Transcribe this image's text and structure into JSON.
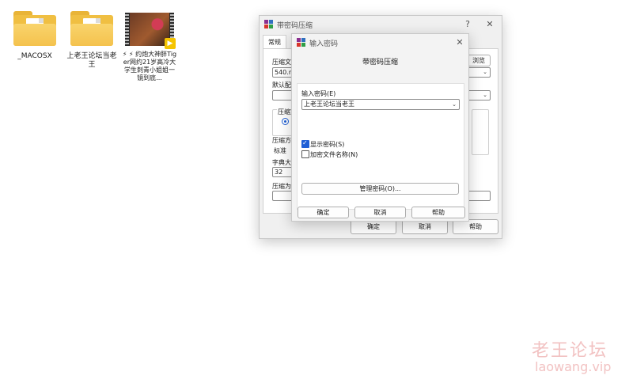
{
  "desktop": {
    "icons": [
      {
        "label": "_MACOSX"
      },
      {
        "label": "上老王论坛当老王"
      },
      {
        "label": "⚡ ⚡ 约炮大神胖Tiger网约21岁高冷大学生刺青小姐姐一镜到底..."
      }
    ]
  },
  "back_window": {
    "title": "带密码压缩",
    "help_glyph": "?",
    "close_glyph": "✕",
    "tab": "常规",
    "archive_label": "压缩文",
    "archive_value": "540.r",
    "browse_button": "浏览(B)...",
    "profile_label": "默认配",
    "format_group_label": "压缩文",
    "method_label": "压缩方",
    "method_value": "标准",
    "dict_label": "字典大",
    "dict_value": "32",
    "split_label": "压缩为",
    "ok_button": "确定",
    "cancel_button": "取消",
    "help_button": "帮助"
  },
  "dialog": {
    "title": "输入密码",
    "close_glyph": "✕",
    "heading": "带密码压缩",
    "password_label": "输入密码(E)",
    "password_value": "上老王论坛当老王",
    "show_password_label": "显示密码(S)",
    "encrypt_names_label": "加密文件名称(N)",
    "show_password_checked": true,
    "encrypt_names_checked": false,
    "manage_button": "管理密码(O)...",
    "ok_button": "确定",
    "cancel_button": "取消",
    "help_button": "帮助"
  },
  "watermark": {
    "line1": "老王论坛",
    "line2": "laowang.vip"
  },
  "colors": {
    "accent": "#1f5fd6",
    "folder": "#f4c24d",
    "watermark": "#f2c2c2"
  }
}
